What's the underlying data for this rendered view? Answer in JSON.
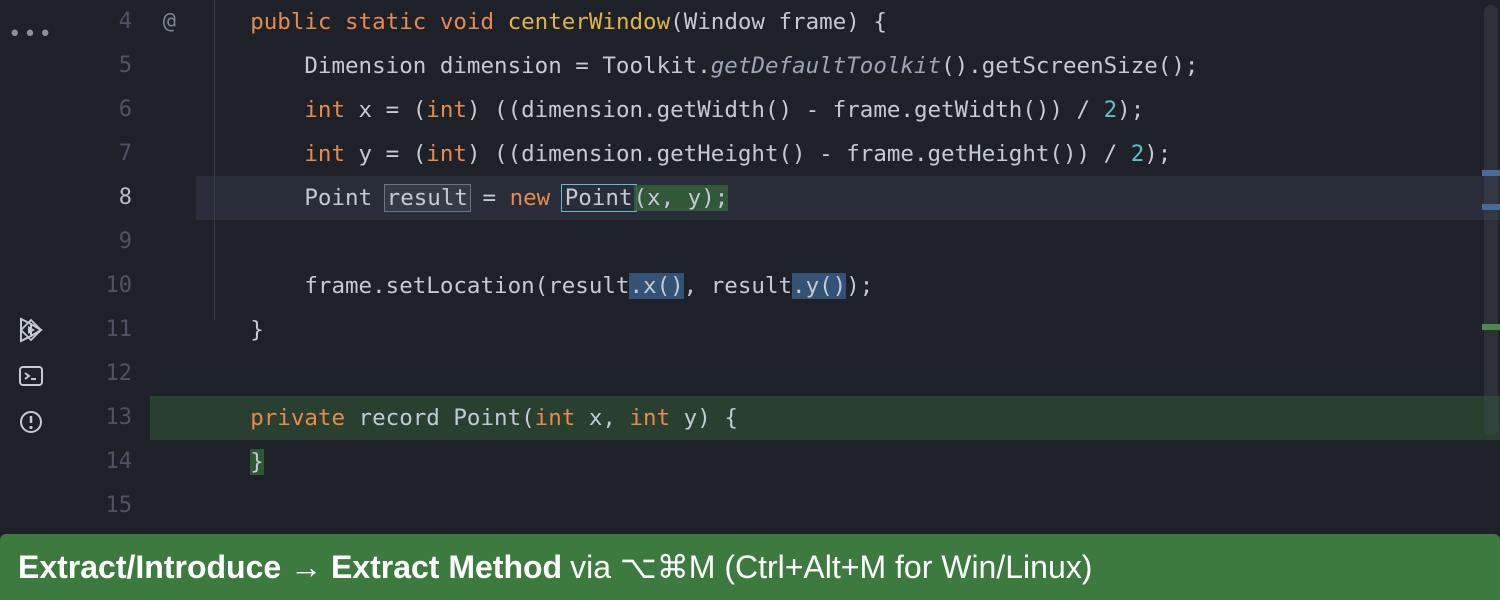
{
  "gutter": {
    "annotation": "@"
  },
  "lineNumbers": [
    "4",
    "5",
    "6",
    "7",
    "8",
    "9",
    "10",
    "11",
    "12",
    "13",
    "14",
    "15"
  ],
  "currentLine": "8",
  "code": {
    "l4": {
      "keywords": "public static void",
      "method": "centerWindow",
      "params_open": "(",
      "param_type": "Window",
      "param_name": " frame",
      "params_close": ") {"
    },
    "l5": {
      "text1": "Dimension dimension = Toolkit.",
      "italic": "getDefaultToolkit",
      "text2": "().getScreenSize();"
    },
    "l6": {
      "kw1": "int",
      "t1": " x = (",
      "kw2": "int",
      "t2": ") ((dimension.getWidth() - frame.getWidth()) / ",
      "num": "2",
      "t3": ");"
    },
    "l7": {
      "kw1": "int",
      "t1": " y = (",
      "kw2": "int",
      "t2": ") ((dimension.getHeight() - frame.getHeight()) / ",
      "num": "2",
      "t3": ");"
    },
    "l8": {
      "type1": "Point",
      "var": "result",
      "eq": " = ",
      "kw": "new",
      "sp": " ",
      "type2": "Point",
      "rest": "(x, y);"
    },
    "l10": {
      "t1": "frame.setLocation(result",
      "hl1": ".x()",
      "t2": ", result",
      "hl2": ".y()",
      "t3": ");"
    },
    "l11": {
      "brace": "}"
    },
    "l13": {
      "kw1": "private",
      "kw2": " record ",
      "name": "Point",
      "open": "(",
      "ptype1": "int",
      "p1": " x, ",
      "ptype2": "int",
      "p2": " y) {"
    },
    "l14": {
      "brace": "}"
    }
  },
  "tip": {
    "bold": "Extract/Introduce → Extract Method",
    "rest": " via ⌥⌘M (Ctrl+Alt+M for Win/Linux)"
  }
}
